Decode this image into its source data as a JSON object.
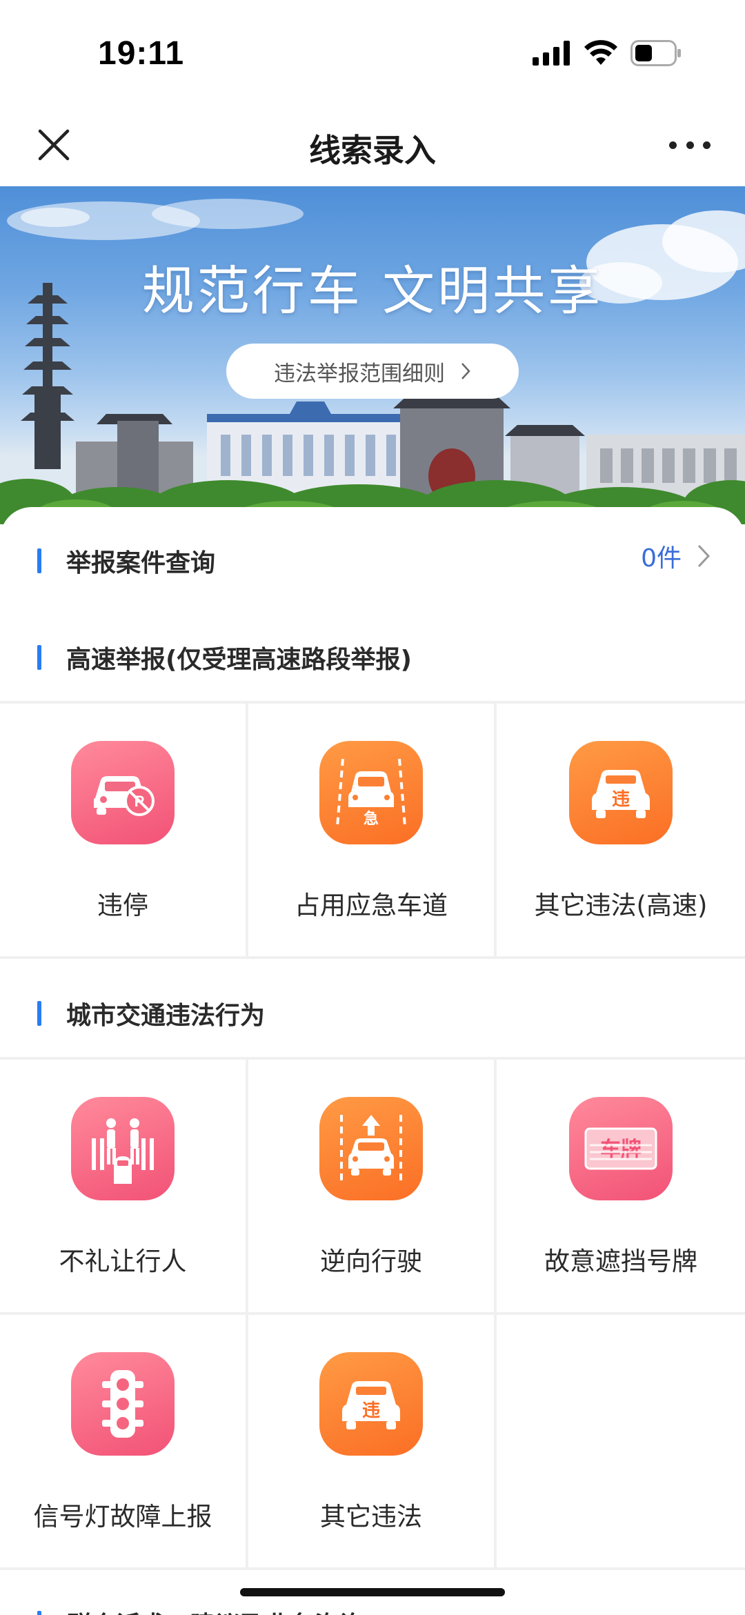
{
  "status_bar": {
    "time": "19:11"
  },
  "nav": {
    "title": "线索录入"
  },
  "banner": {
    "slogan": "规范行车 文明共享",
    "rules_link": "违法举报范围细则"
  },
  "query": {
    "title": "举报案件查询",
    "count": "0件"
  },
  "highway": {
    "title": "高速举报(仅受理高速路段举报)",
    "items": [
      {
        "label": "违停",
        "icon": "no-parking-car-icon",
        "color": "#f25276"
      },
      {
        "label": "占用应急车道",
        "icon": "emergency-lane-car-icon",
        "color": "#fb6f25"
      },
      {
        "label": "其它违法(高速)",
        "icon": "violation-car-icon",
        "color": "#fb6f25"
      }
    ]
  },
  "city": {
    "title": "城市交通违法行为",
    "items": [
      {
        "label": "不礼让行人",
        "icon": "pedestrian-crossing-icon",
        "color": "#f25276"
      },
      {
        "label": "逆向行驶",
        "icon": "wrong-way-car-icon",
        "color": "#fb6f25"
      },
      {
        "label": "故意遮挡号牌",
        "icon": "license-plate-icon",
        "color": "#f25276"
      },
      {
        "label": "信号灯故障上报",
        "icon": "traffic-light-icon",
        "color": "#f25276"
      },
      {
        "label": "其它违法",
        "icon": "violation-car-icon",
        "color": "#fb6f25"
      }
    ]
  },
  "next_section": {
    "title": "群众诉求、建议及业务咨询"
  },
  "colors": {
    "accent_blue": "#2a7cf0",
    "count_blue": "#3a6dd8",
    "pink": "#f25276",
    "orange": "#fb6f25"
  }
}
